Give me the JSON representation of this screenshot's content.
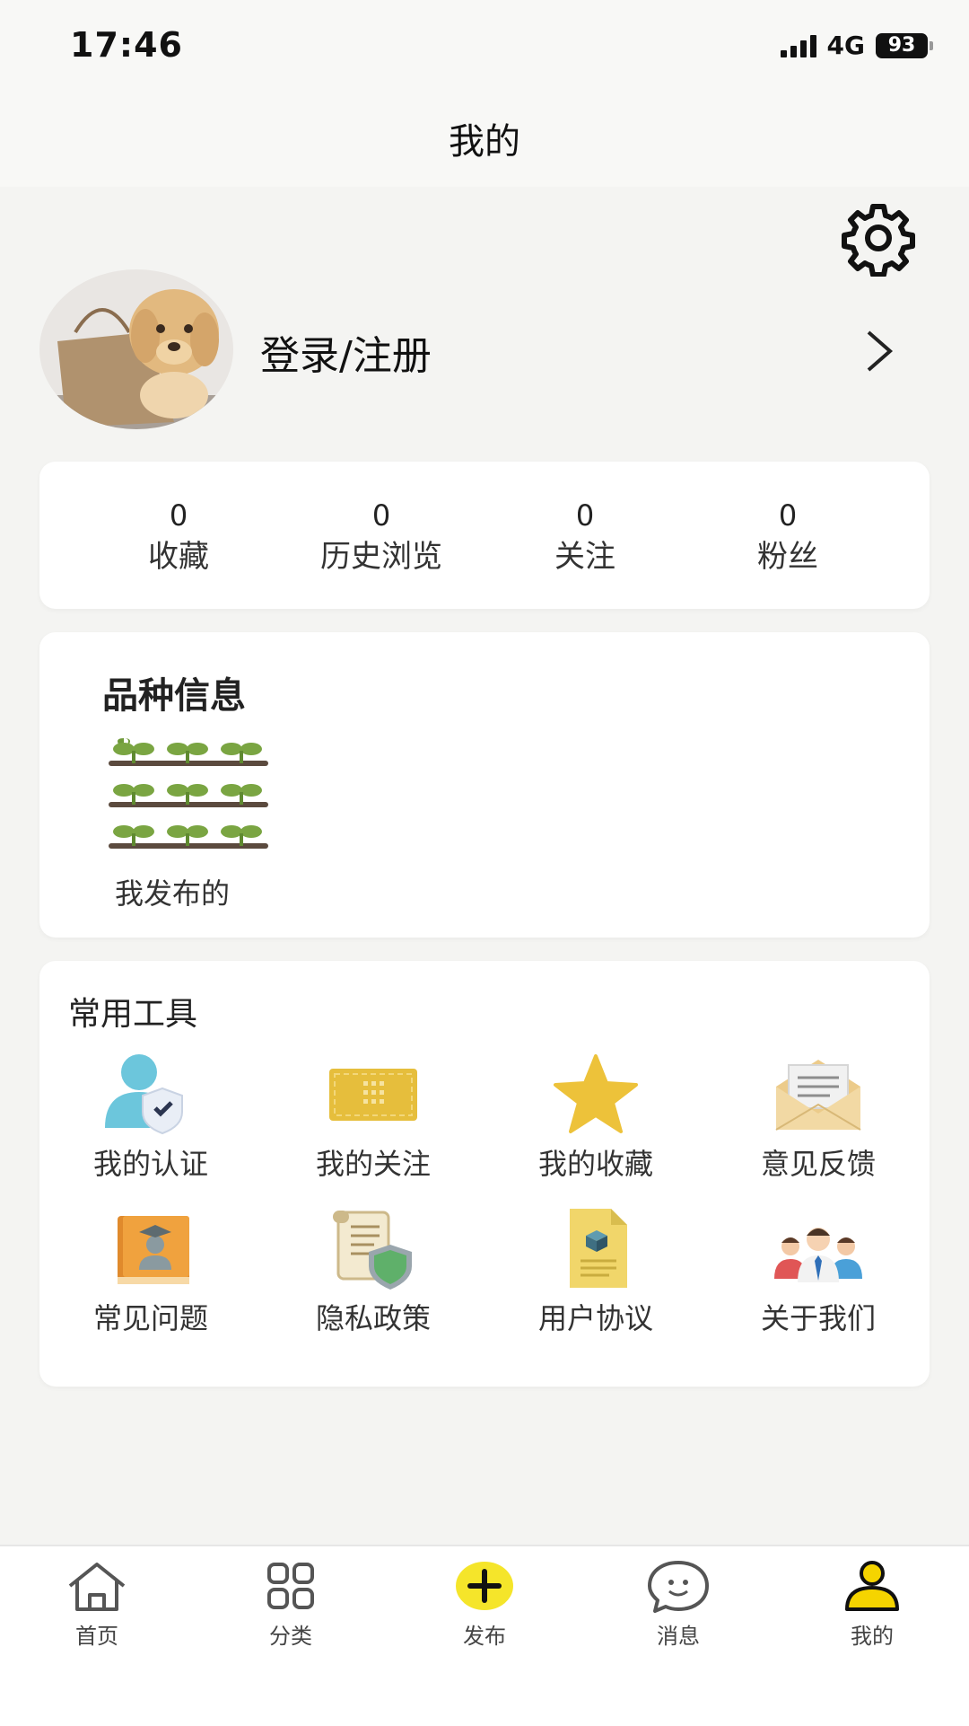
{
  "status_bar": {
    "time": "17:46",
    "network": "4G",
    "battery": "93"
  },
  "header": {
    "title": "我的"
  },
  "profile": {
    "login_label": "登录/注册",
    "avatar_icon": "dog-photo-avatar"
  },
  "stats": [
    {
      "value": "0",
      "label": "收藏"
    },
    {
      "value": "0",
      "label": "历史浏览"
    },
    {
      "value": "0",
      "label": "关注"
    },
    {
      "value": "0",
      "label": "粉丝"
    }
  ],
  "variety": {
    "title": "品种信息",
    "item_label": "我发布的",
    "item_icon": "sprouts-icon"
  },
  "tools": {
    "title": "常用工具",
    "items": [
      {
        "label": "我的认证",
        "icon": "user-shield-icon"
      },
      {
        "label": "我的关注",
        "icon": "ticket-icon"
      },
      {
        "label": "我的收藏",
        "icon": "star-icon"
      },
      {
        "label": "意见反馈",
        "icon": "envelope-icon"
      },
      {
        "label": "常见问题",
        "icon": "book-icon"
      },
      {
        "label": "隐私政策",
        "icon": "scroll-shield-icon"
      },
      {
        "label": "用户协议",
        "icon": "document-icon"
      },
      {
        "label": "关于我们",
        "icon": "team-icon"
      }
    ]
  },
  "bottom_nav": [
    {
      "label": "首页",
      "icon": "home-icon"
    },
    {
      "label": "分类",
      "icon": "grid-icon"
    },
    {
      "label": "发布",
      "icon": "plus-icon"
    },
    {
      "label": "消息",
      "icon": "chat-icon"
    },
    {
      "label": "我的",
      "icon": "user-icon",
      "active": true
    }
  ],
  "colors": {
    "accent": "#f5d400",
    "background": "#f4f4f2"
  }
}
